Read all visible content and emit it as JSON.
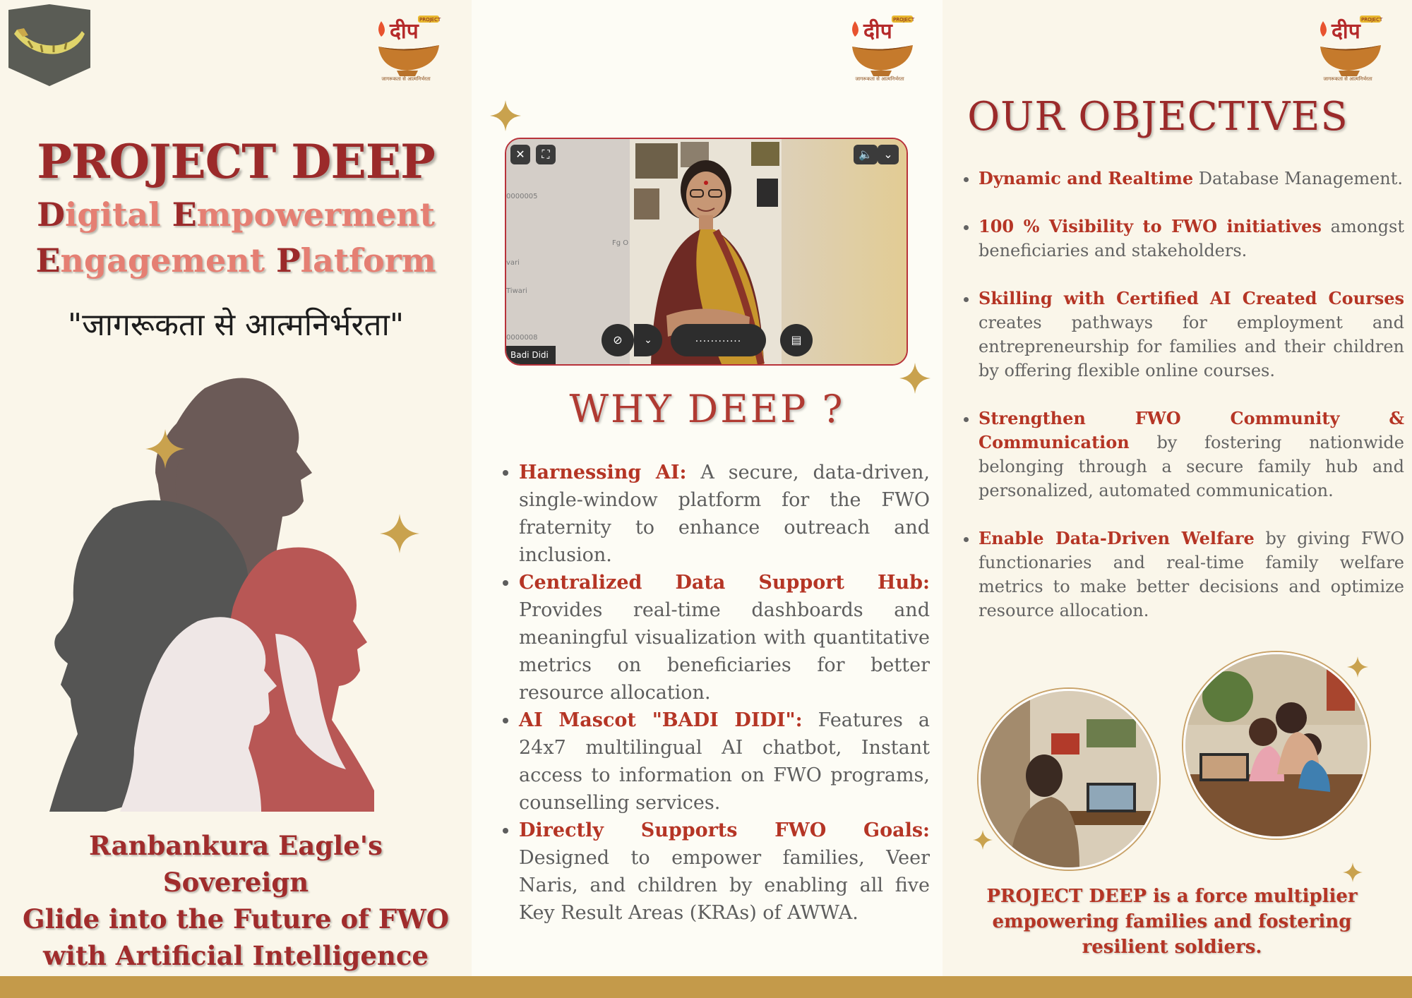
{
  "logo": {
    "hindi_text": "दीप",
    "badge_text": "PROJECT",
    "caption": "जागरूकता से आत्मनिर्भरता"
  },
  "left_panel": {
    "title": "PROJECT DEEP",
    "subtitle_line1": {
      "cap1": "D",
      "rest1": "igital ",
      "cap2": "E",
      "rest2": "mpowerment"
    },
    "subtitle_line2": {
      "cap1": "E",
      "rest1": "ngagement ",
      "cap2": "P",
      "rest2": "latform"
    },
    "tagline": "\"जागरूकता से आत्मनिर्भरता\"",
    "footer_line1": "Ranbankura Eagle's Sovereign",
    "footer_line2": "Glide into the Future of FWO",
    "footer_line3": "with Artificial Intelligence"
  },
  "video_call": {
    "participant_name": "Badi Didi",
    "row_texts": [
      "0000005",
      "Fg O",
      "vari",
      "Tiwari",
      "0000008"
    ],
    "dots": "............",
    "icons": [
      "close-icon",
      "fullscreen-icon",
      "volume-icon",
      "chevron-down-icon",
      "mic-off-icon",
      "chat-icon"
    ]
  },
  "why_deep": {
    "heading": "WHY DEEP ?",
    "items": [
      {
        "label": "Harnessing AI:",
        "text": " A secure, data-driven, single-window platform for the FWO fraternity to enhance outreach and inclusion."
      },
      {
        "label": "Centralized Data Support Hub:",
        "text": " Provides real-time dashboards and meaningful visualization with quantitative metrics on beneficiaries for better resource allocation."
      },
      {
        "label": "AI Mascot \"BADI DIDI\":",
        "text": " Features a 24x7 multilingual AI chatbot, Instant access to information on FWO programs, counselling services."
      },
      {
        "label": "Directly Supports FWO Goals:",
        "text": " Designed to empower families, Veer Naris, and children by enabling all five Key Result Areas (KRAs) of AWWA."
      }
    ]
  },
  "objectives": {
    "heading": "OUR OBJECTIVES",
    "items": [
      {
        "label": "Dynamic and Realtime",
        "text": " Database Management."
      },
      {
        "label": "100 % Visibility to FWO initiatives",
        "text": " amongst beneficiaries and stakeholders."
      },
      {
        "label": "Skilling with Certified AI Created Courses",
        "text": " creates pathways for employment and entrepreneurship for families and their children by offering flexible online courses."
      },
      {
        "label": "Strengthen FWO Community & Communication",
        "text": " by fostering nationwide belonging through a secure family hub and personalized, automated communication."
      },
      {
        "label": "Enable Data-Driven Welfare",
        "text": " by giving FWO functionaries and real-time family welfare metrics to make better decisions and optimize resource allocation."
      }
    ],
    "footer_line1": "PROJECT DEEP is a force multiplier",
    "footer_line2": "empowering families and fostering",
    "footer_line3": "resilient soldiers."
  },
  "colors": {
    "accent_red": "#9b2a2a",
    "salmon": "#e57f73",
    "gold": "#c49a4a",
    "body_text": "#5d5d5d"
  }
}
